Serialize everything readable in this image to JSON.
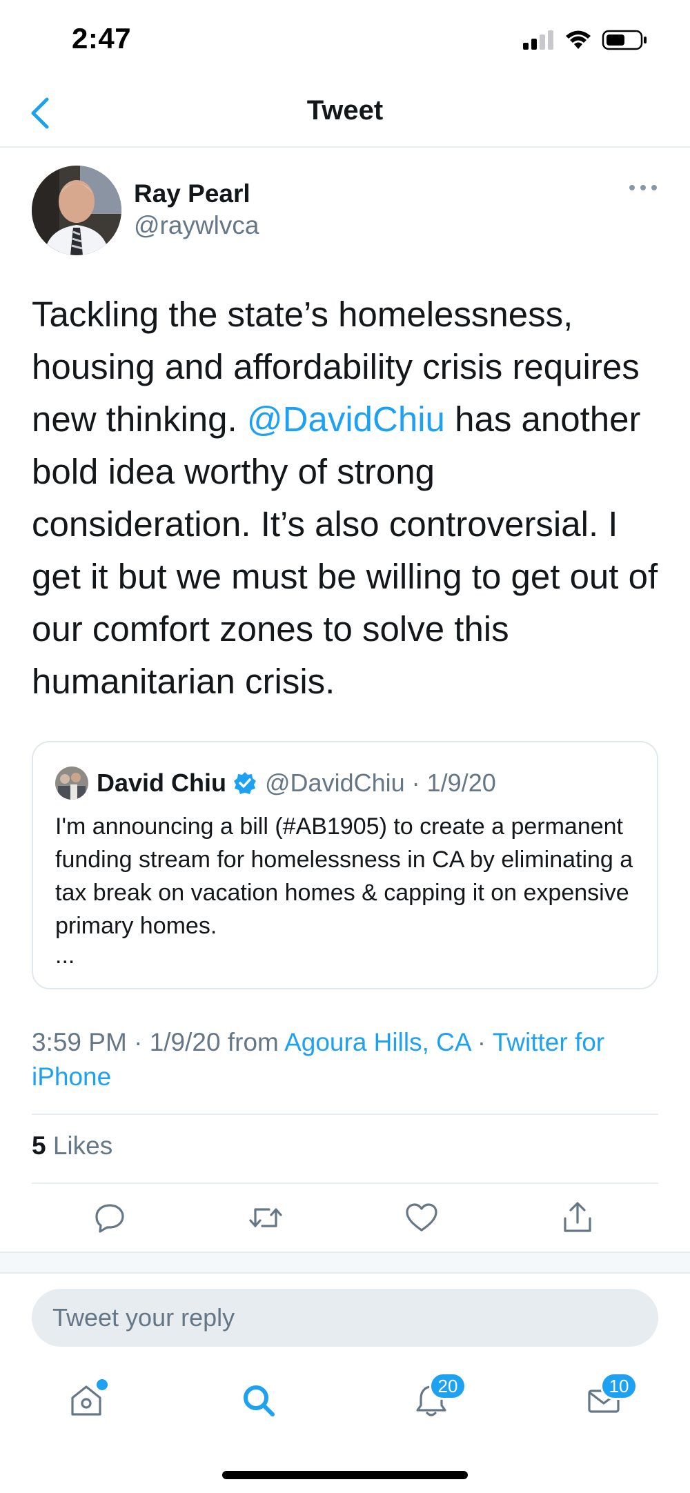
{
  "status_bar": {
    "time": "2:47"
  },
  "nav": {
    "title": "Tweet",
    "back_icon": "chevron-left-icon"
  },
  "tweet": {
    "author_name": "Ray Pearl",
    "author_handle": "@raywlvca",
    "text_before_mention": "Tackling the state’s homelessness, housing and affordability crisis requires new thinking. ",
    "mention": "@DavidChiu",
    "text_after_mention": " has another bold idea worthy of strong consideration. It’s also controversial. I get it but we must be willing to get out of our comfort zones to solve this humanitarian crisis.",
    "time": "3:59 PM",
    "date": "1/9/20",
    "from_label": "from",
    "location": "Agoura Hills, CA",
    "source": "Twitter for iPhone",
    "likes_count": "5",
    "likes_label": "Likes"
  },
  "quoted_tweet": {
    "author_name": "David Chiu",
    "author_handle": "@DavidChiu",
    "date": "1/9/20",
    "text": "I'm announcing a bill (#AB1905) to create a permanent funding stream for homelessness in CA by eliminating a tax break on vacation homes & capping it on expensive primary homes.",
    "ellipsis": "..."
  },
  "actions": [
    "reply-icon",
    "retweet-icon",
    "like-icon",
    "share-icon"
  ],
  "reply": {
    "placeholder": "Tweet your reply"
  },
  "tab_bar": {
    "tabs": [
      {
        "name": "home",
        "icon": "home-icon",
        "badge": ""
      },
      {
        "name": "search",
        "icon": "search-icon",
        "badge": ""
      },
      {
        "name": "notifications",
        "icon": "bell-icon",
        "badge": "20"
      },
      {
        "name": "messages",
        "icon": "mail-icon",
        "badge": "10"
      }
    ]
  },
  "colors": {
    "accent": "#1da1f2",
    "text": "#14171a",
    "secondary_text": "#657786",
    "border": "#e6ecf0"
  }
}
